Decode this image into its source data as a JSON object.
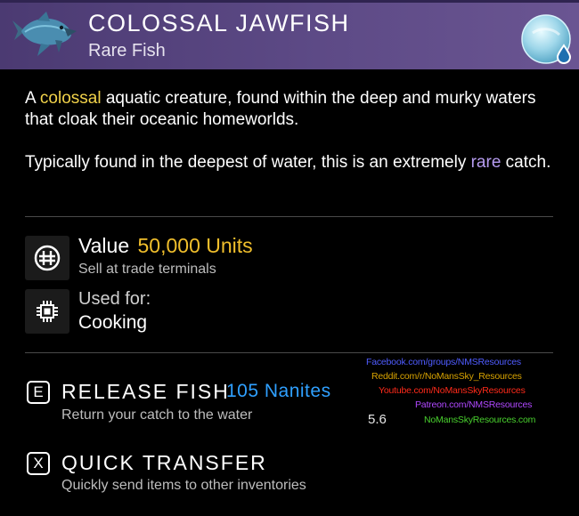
{
  "header": {
    "title": "COLOSSAL JAWFISH",
    "subtitle": "Rare Fish",
    "fish_icon": "fish-icon",
    "resource_icon": "water-droplet-icon"
  },
  "description": {
    "p1_before": "A ",
    "p1_highlight": "colossal",
    "p1_after": " aquatic creature, found within the deep and murky waters that cloak their oceanic homeworlds.",
    "p2_before": "Typically found in the deepest of water, this is an extremely ",
    "p2_highlight": "rare",
    "p2_after": " catch."
  },
  "stats": {
    "value_label": "Value",
    "value_amount": "50,000 Units",
    "value_hint": "Sell at trade terminals",
    "used_label": "Used for:",
    "used_value": "Cooking"
  },
  "actions": {
    "release": {
      "key": "E",
      "label": "RELEASE FISH",
      "reward": "105 Nanites",
      "hint": "Return your catch to the water"
    },
    "transfer": {
      "key": "X",
      "label": "QUICK TRANSFER",
      "hint": "Quickly send items to other inventories"
    }
  },
  "watermark": {
    "line1": "Facebook.com/groups/NMSResources",
    "line2": "Reddit.com/r/NoMansSky_Resources",
    "line3": "Youtube.com/NoMansSkyResources",
    "line4": "Patreon.com/NMSResources",
    "line5": "NoMansSkyResources.com",
    "version": "5.6"
  },
  "colors": {
    "header_bg": "#5d4a86",
    "highlight_yellow": "#f1d24a",
    "highlight_purple": "#b69cf0",
    "value_gold": "#f1bf2c",
    "nanites_blue": "#2fa0ff"
  }
}
